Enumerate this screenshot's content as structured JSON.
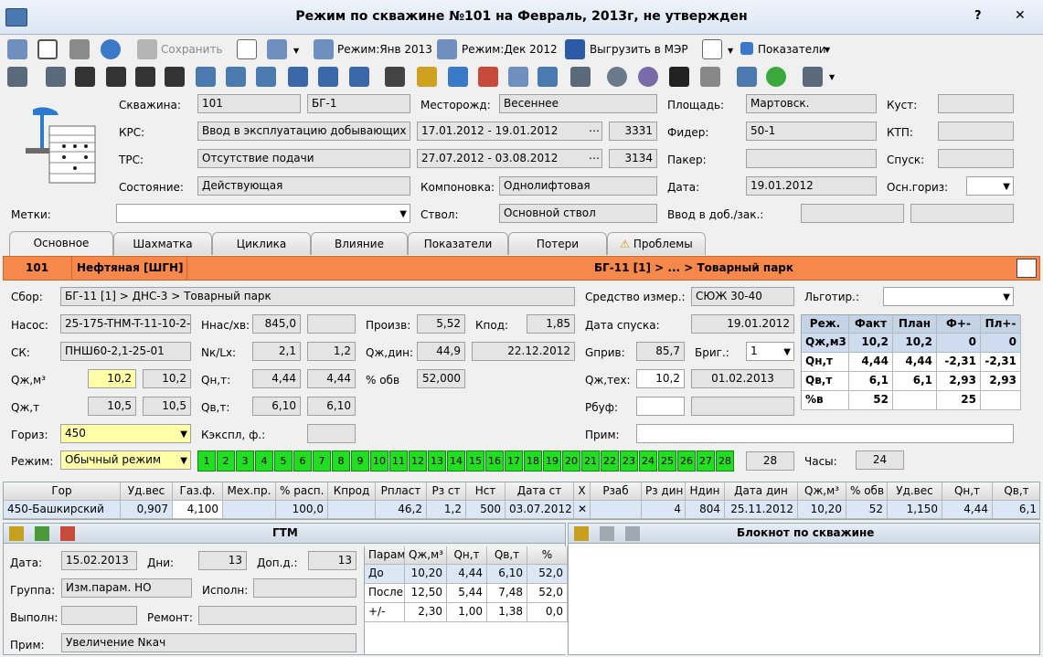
{
  "window": {
    "title": "Режим по скважине №101 на Февраль, 2013г, не утвержден",
    "help": "?",
    "close": "✕"
  },
  "toolbar": {
    "save": "Сохранить",
    "mode_jan": "Режим:Янв 2013",
    "mode_dec": "Режим:Дек 2012",
    "export": "Выгрузить в МЭР",
    "indicators": "Показатели"
  },
  "header": {
    "well_label": "Скважина:",
    "well": "101",
    "bush_code": "БГ-1",
    "field_label": "Месторожд:",
    "field": "Весеннее",
    "area_label": "Площадь:",
    "area": "Мартовск.",
    "cluster_label": "Куст:",
    "cluster": "",
    "krs_label": "КРС:",
    "krs": "Ввод в эксплуатацию добывающих скв",
    "krs_dates": "17.01.2012 - 19.01.2012",
    "krs_num": "3331",
    "feeder_label": "Фидер:",
    "feeder": "50-1",
    "ktp_label": "КТП:",
    "ktp": "",
    "trs_label": "ТРС:",
    "trs": "Отсутствие подачи",
    "trs_dates": "27.07.2012 - 03.08.2012",
    "trs_num": "3134",
    "packer_label": "Пакер:",
    "packer": "",
    "descent_label": "Спуск:",
    "descent": "",
    "state_label": "Состояние:",
    "state": "Действующая",
    "layout_label": "Компоновка:",
    "layout": "Однолифтовая",
    "date_label": "Дата:",
    "date": "19.01.2012",
    "main_horiz_label": "Осн.гориз:",
    "main_horiz": "",
    "marks_label": "Метки:",
    "marks": "",
    "trunk_label": "Ствол:",
    "trunk": "Основной ствол",
    "commission_label": "Ввод в доб./зак.:",
    "commission1": "",
    "commission2": ""
  },
  "tabs": [
    "Основное",
    "Шахматка",
    "Циклика",
    "Влияние",
    "Показатели",
    "Потери",
    "Проблемы"
  ],
  "banner": {
    "num": "101",
    "type": "Нефтяная [ШГН]",
    "path": "БГ-11 [1] > ... > Товарный парк"
  },
  "main": {
    "collect_label": "Сбор:",
    "collect": "БГ-11 [1] > ДНС-3 > Товарный парк",
    "meter_label": "Средство измер.:",
    "meter": "СЮЖ 30-40",
    "benefit_label": "Льготир.:",
    "benefit": "",
    "pump_label": "Насос:",
    "pump": "25-175-THM-T-11-10-2-",
    "nnas_label": "Ннас/хв:",
    "nnas": "845,0",
    "nnas2": "",
    "prod_label": "Произв:",
    "prod": "5,52",
    "kprod_label": "Кпод:",
    "kprod": "1,85",
    "descent_date_label": "Дата спуска:",
    "descent_date": "19.01.2012",
    "sk_label": "СК:",
    "sk": "ПНШ60-2,1-25-01",
    "nk_label": "Nк/Lх:",
    "nk1": "2,1",
    "nk2": "1,2",
    "qdyn_label": "Qж,дин:",
    "qdyn": "44,9",
    "qdyn_date": "22.12.2012",
    "gpriv_label": "Gприв:",
    "gpriv": "85,7",
    "brig_label": "Бриг.:",
    "brig": "1",
    "qm3_label": "Qж,м³",
    "qm3_1": "10,2",
    "qm3_2": "10,2",
    "qnt_label": "Qн,т:",
    "qnt1": "4,44",
    "qnt2": "4,44",
    "pobv_label": "% обв",
    "pobv": "52,000",
    "qtech_label": "Qж,тех:",
    "qtech": "10,2",
    "qtech_date": "01.02.2013",
    "qt_label": "Qж,т",
    "qt1": "10,5",
    "qt2": "10,5",
    "qvt_label": "Qв,т:",
    "qvt1": "6,10",
    "qvt2": "6,10",
    "rbuf_label": "Рбуф:",
    "rbuf": "",
    "rbuf2": "",
    "horiz_label": "Гориз:",
    "horiz": "450",
    "kexpl_label": "Кэкспл, ф.:",
    "kexpl": "",
    "note_label": "Прим:",
    "note": "",
    "mode_label": "Режим:",
    "mode": "Обычный режим",
    "days": [
      "1",
      "2",
      "3",
      "4",
      "5",
      "6",
      "7",
      "8",
      "9",
      "10",
      "11",
      "12",
      "13",
      "14",
      "15",
      "16",
      "17",
      "18",
      "19",
      "20",
      "21",
      "22",
      "23",
      "24",
      "25",
      "26",
      "27",
      "28"
    ],
    "days_count": "28",
    "hours_label": "Часы:",
    "hours": "24"
  },
  "plan_table": {
    "headers": [
      "Реж.",
      "Факт",
      "План",
      "Ф+-",
      "Пл+-"
    ],
    "rows": [
      [
        "Qж,м3",
        "10,2",
        "10,2",
        "0",
        "0"
      ],
      [
        "Qн,т",
        "4,44",
        "4,44",
        "-2,31",
        "-2,31"
      ],
      [
        "Qв,т",
        "6,1",
        "6,1",
        "2,93",
        "2,93"
      ],
      [
        "%в",
        "52",
        "",
        "25",
        ""
      ]
    ]
  },
  "horizon_table": {
    "headers": [
      "Гор",
      "Уд.вес",
      "Газ.ф.",
      "Мех.пр.",
      "% расп.",
      "Кпрод",
      "Рпласт",
      "Рз ст",
      "Нст",
      "Дата ст",
      "X",
      "Рзаб",
      "Рз дин",
      "Ндин",
      "Дата дин",
      "Qж,м³",
      "% обв",
      "Уд.вес",
      "Qн,т",
      "Qв,т"
    ],
    "row": [
      "450-Башкирский",
      "0,907",
      "4,100",
      "",
      "100,0",
      "",
      "46,2",
      "1,2",
      "500",
      "03.07.2012",
      "✕",
      "",
      "4",
      "804",
      "25.11.2012",
      "10,20",
      "52",
      "1,150",
      "4,44",
      "6,1"
    ]
  },
  "gtm": {
    "title": "ГТМ",
    "date_label": "Дата:",
    "date": "15.02.2013",
    "days_label": "Дни:",
    "days": "13",
    "extra_label": "Доп.д.:",
    "extra": "13",
    "group_label": "Группа:",
    "group": "Изм.парам. НО",
    "executor_label": "Исполн:",
    "executor": "",
    "done_label": "Выполн:",
    "done": "",
    "repair_label": "Ремонт:",
    "repair": "",
    "note_label": "Прим:",
    "note": "Увеличение Nкач",
    "params": {
      "headers": [
        "Парам.",
        "Qж,м³",
        "Qн,т",
        "Qв,т",
        "%"
      ],
      "rows": [
        [
          "До",
          "10,20",
          "4,44",
          "6,10",
          "52,0"
        ],
        [
          "После",
          "12,50",
          "5,44",
          "7,48",
          "52,0"
        ],
        [
          "+/-",
          "2,30",
          "1,00",
          "1,38",
          "0,0"
        ]
      ]
    }
  },
  "notebook": {
    "title": "Блокнот по скважине"
  }
}
